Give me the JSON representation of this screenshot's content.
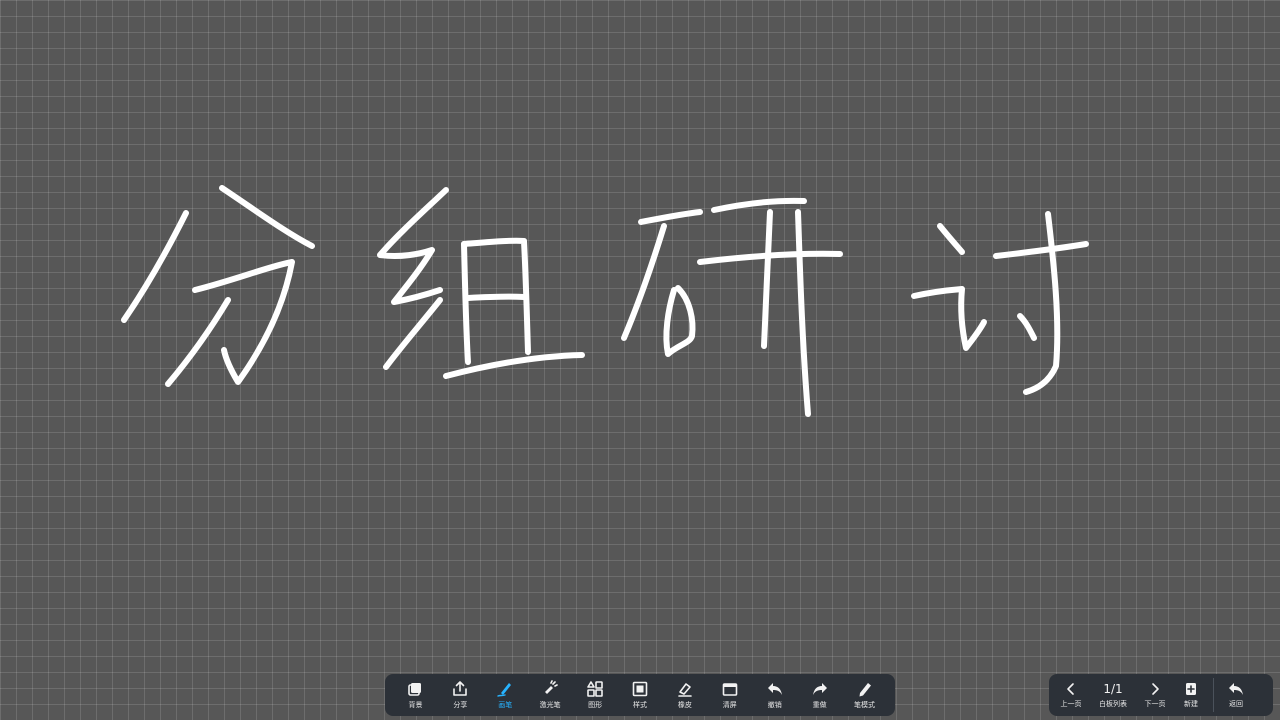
{
  "board": {
    "handwriting": "分组研讨"
  },
  "toolbar": {
    "items": [
      {
        "label": "背景",
        "icon": "background-icon"
      },
      {
        "label": "分享",
        "icon": "share-icon"
      },
      {
        "label": "画笔",
        "icon": "pen-icon",
        "active": true
      },
      {
        "label": "激光笔",
        "icon": "laser-pointer-icon"
      },
      {
        "label": "图形",
        "icon": "shapes-icon"
      },
      {
        "label": "样式",
        "icon": "style-icon"
      },
      {
        "label": "橡皮",
        "icon": "eraser-icon"
      },
      {
        "label": "清屏",
        "icon": "clear-screen-icon"
      },
      {
        "label": "撤销",
        "icon": "undo-icon"
      },
      {
        "label": "重做",
        "icon": "redo-icon"
      },
      {
        "label": "笔模式",
        "icon": "pen-mode-icon"
      }
    ],
    "active_color": "#27b3ff"
  },
  "pager": {
    "prev_label": "上一页",
    "count": "1/1",
    "list_label": "白板列表",
    "next_label": "下一页",
    "new_label": "新建",
    "back_label": "返回"
  }
}
